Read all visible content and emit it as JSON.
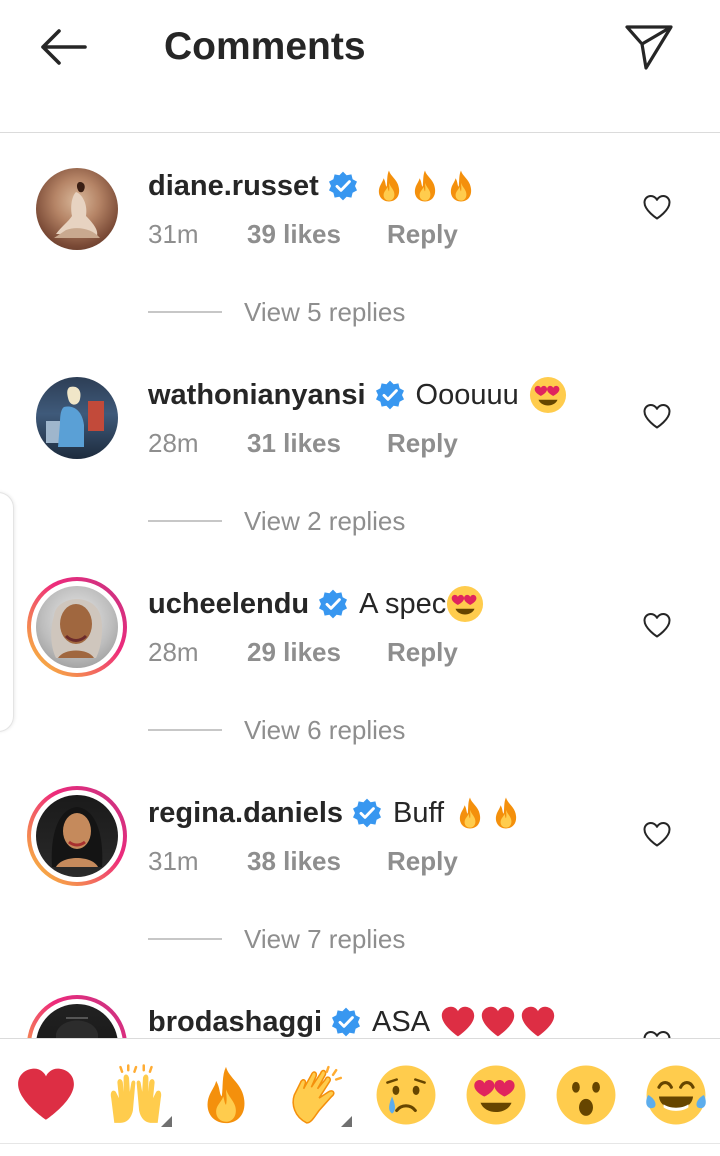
{
  "header": {
    "title": "Comments",
    "back_icon": "arrow-left-icon",
    "direct_icon": "paper-plane-icon"
  },
  "comments": [
    {
      "username": "diane.russet",
      "verified": true,
      "text": "",
      "emojis": [
        "fire",
        "fire",
        "fire"
      ],
      "time": "31m",
      "likes": "39 likes",
      "reply": "Reply",
      "view_replies": "View 5 replies",
      "story_ring": false
    },
    {
      "username": "wathonianyansi",
      "verified": true,
      "text": "Ooouuu",
      "emojis": [
        "heart-eyes"
      ],
      "time": "28m",
      "likes": "31 likes",
      "reply": "Reply",
      "view_replies": "View 2 replies",
      "story_ring": false
    },
    {
      "username": "ucheelendu",
      "verified": true,
      "text": "A spec",
      "emojis": [
        "heart-eyes"
      ],
      "time": "28m",
      "likes": "29 likes",
      "reply": "Reply",
      "view_replies": "View 6 replies",
      "story_ring": true
    },
    {
      "username": "regina.daniels",
      "verified": true,
      "text": "Buff",
      "emojis": [
        "fire",
        "fire"
      ],
      "time": "31m",
      "likes": "38 likes",
      "reply": "Reply",
      "view_replies": "View 7 replies",
      "story_ring": true
    },
    {
      "username": "brodashaggi",
      "verified": true,
      "text": "ASA",
      "emojis": [
        "red-heart",
        "red-heart",
        "red-heart"
      ],
      "story_ring": true
    }
  ],
  "quick_reactions": [
    "red-heart",
    "raising-hands",
    "fire",
    "clapping-hands",
    "crying-face",
    "heart-eyes",
    "surprised-face",
    "tears-of-joy"
  ],
  "colors": {
    "text": "#262626",
    "secondary": "#8e8e8e",
    "verified_blue": "#3897f0",
    "heart_red": "#ed1c24"
  }
}
